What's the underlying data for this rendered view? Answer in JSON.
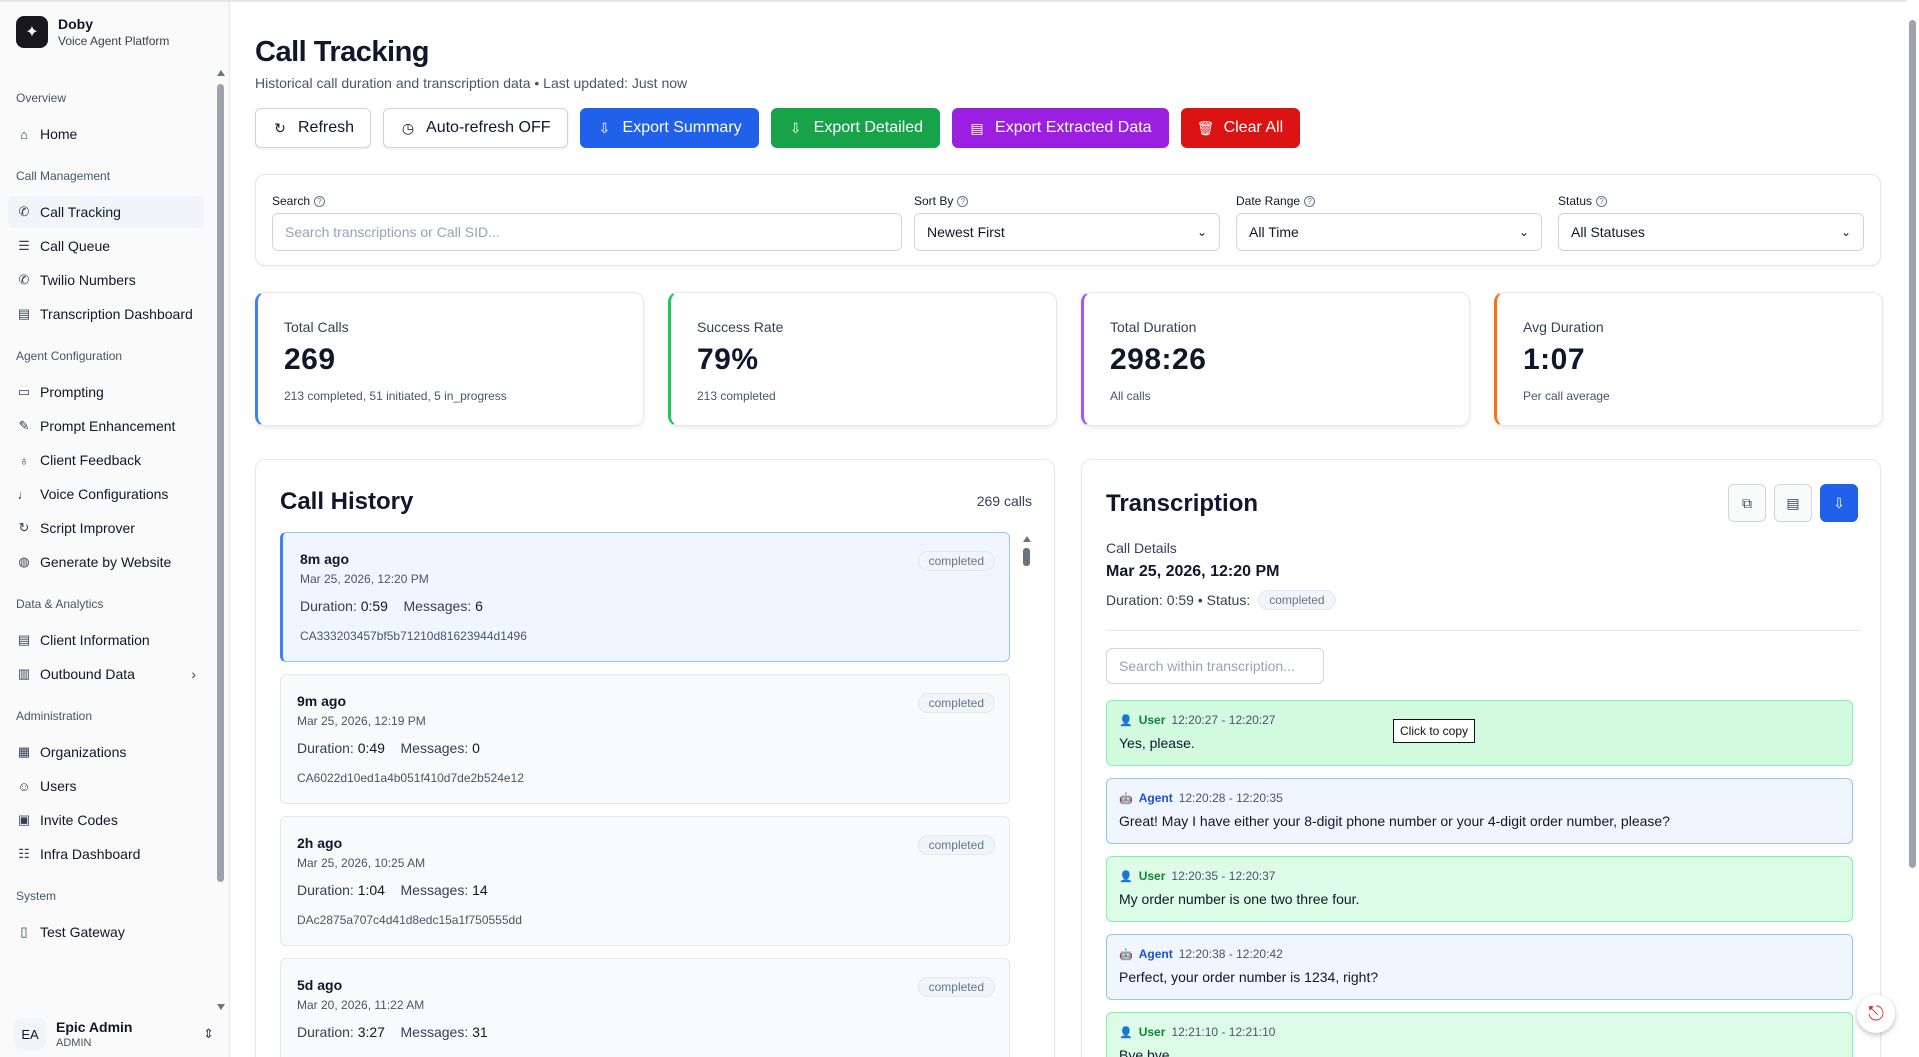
{
  "brand": {
    "name": "Doby",
    "subtitle": "Voice Agent Platform"
  },
  "sidebar": {
    "sections": [
      {
        "title": "Overview",
        "items": [
          {
            "label": "Home",
            "icon": "home-icon"
          }
        ]
      },
      {
        "title": "Call Management",
        "items": [
          {
            "label": "Call Tracking",
            "icon": "phone-icon",
            "active": true
          },
          {
            "label": "Call Queue",
            "icon": "list-icon"
          },
          {
            "label": "Twilio Numbers",
            "icon": "phone-icon"
          },
          {
            "label": "Transcription Dashboard",
            "icon": "document-icon"
          }
        ]
      },
      {
        "title": "Agent Configuration",
        "items": [
          {
            "label": "Prompting",
            "icon": "message-icon"
          },
          {
            "label": "Prompt Enhancement",
            "icon": "wand-icon"
          },
          {
            "label": "Client Feedback",
            "icon": "lightbulb-icon"
          },
          {
            "label": "Voice Configurations",
            "icon": "microphone-icon"
          },
          {
            "label": "Script Improver",
            "icon": "refresh-icon"
          },
          {
            "label": "Generate by Website",
            "icon": "globe-icon"
          }
        ]
      },
      {
        "title": "Data & Analytics",
        "items": [
          {
            "label": "Client Information",
            "icon": "document-icon"
          },
          {
            "label": "Outbound Data",
            "icon": "bar-chart-icon",
            "expandable": true
          }
        ]
      },
      {
        "title": "Administration",
        "items": [
          {
            "label": "Organizations",
            "icon": "building-icon"
          },
          {
            "label": "Users",
            "icon": "users-icon"
          },
          {
            "label": "Invite Codes",
            "icon": "ticket-icon"
          },
          {
            "label": "Infra Dashboard",
            "icon": "server-icon"
          }
        ]
      },
      {
        "title": "System",
        "items": [
          {
            "label": "Test Gateway",
            "icon": "server-icon"
          }
        ]
      }
    ],
    "user": {
      "initials": "EA",
      "name": "Epic Admin",
      "role": "ADMIN"
    }
  },
  "header": {
    "title": "Call Tracking",
    "subtitle": "Historical call duration and transcription data • Last updated: Just now"
  },
  "toolbar": {
    "refresh": "Refresh",
    "auto_refresh": "Auto-refresh OFF",
    "export_summary": "Export Summary",
    "export_detailed": "Export Detailed",
    "export_extracted": "Export Extracted Data",
    "clear_all": "Clear All"
  },
  "filters": {
    "search_label": "Search",
    "search_placeholder": "Search transcriptions or Call SID...",
    "sort_label": "Sort By",
    "sort_value": "Newest First",
    "date_label": "Date Range",
    "date_value": "All Time",
    "status_label": "Status",
    "status_value": "All Statuses"
  },
  "stats": [
    {
      "label": "Total Calls",
      "value": "269",
      "note": "213 completed, 51 initiated, 5 in_progress",
      "color": "#3b82f6"
    },
    {
      "label": "Success Rate",
      "value": "79%",
      "note": "213 completed",
      "color": "#22c55e"
    },
    {
      "label": "Total Duration",
      "value": "298:26",
      "note": "All calls",
      "color": "#a855f7"
    },
    {
      "label": "Avg Duration",
      "value": "1:07",
      "note": "Per call average",
      "color": "#f97316"
    }
  ],
  "history": {
    "title": "Call History",
    "count": "269 calls",
    "duration_label": "Duration:",
    "messages_label": "Messages:",
    "calls": [
      {
        "ago": "8m ago",
        "date": "Mar 25, 2026, 12:20 PM",
        "duration": "0:59",
        "messages": "6",
        "sid": "CA333203457bf5b71210d81623944d1496",
        "status": "completed",
        "selected": true
      },
      {
        "ago": "9m ago",
        "date": "Mar 25, 2026, 12:19 PM",
        "duration": "0:49",
        "messages": "0",
        "sid": "CA6022d10ed1a4b051f410d7de2b524e12",
        "status": "completed"
      },
      {
        "ago": "2h ago",
        "date": "Mar 25, 2026, 10:25 AM",
        "duration": "1:04",
        "messages": "14",
        "sid": "DAc2875a707c4d41d8edc15a1f750555dd",
        "status": "completed"
      },
      {
        "ago": "5d ago",
        "date": "Mar 20, 2026, 11:22 AM",
        "duration": "3:27",
        "messages": "31",
        "sid": "",
        "status": "completed"
      }
    ]
  },
  "transcription": {
    "title": "Transcription",
    "details_label": "Call Details",
    "date": "Mar 25, 2026, 12:20 PM",
    "duration_status": "Duration: 0:59 • Status:",
    "status": "completed",
    "search_placeholder": "Search within transcription...",
    "tooltip": "Click to copy",
    "messages": [
      {
        "role": "User",
        "time": "12:20:27 - 12:20:27",
        "text": "Yes, please."
      },
      {
        "role": "Agent",
        "time": "12:20:28 - 12:20:35",
        "text": "Great! May I have either your 8-digit phone number or your 4-digit order number, please?"
      },
      {
        "role": "User",
        "time": "12:20:35 - 12:20:37",
        "text": "My order number is one two three four."
      },
      {
        "role": "Agent",
        "time": "12:20:38 - 12:20:42",
        "text": "Perfect, your order number is 1234, right?"
      },
      {
        "role": "User",
        "time": "12:21:10 - 12:21:10",
        "text": "Bye bye."
      }
    ]
  }
}
